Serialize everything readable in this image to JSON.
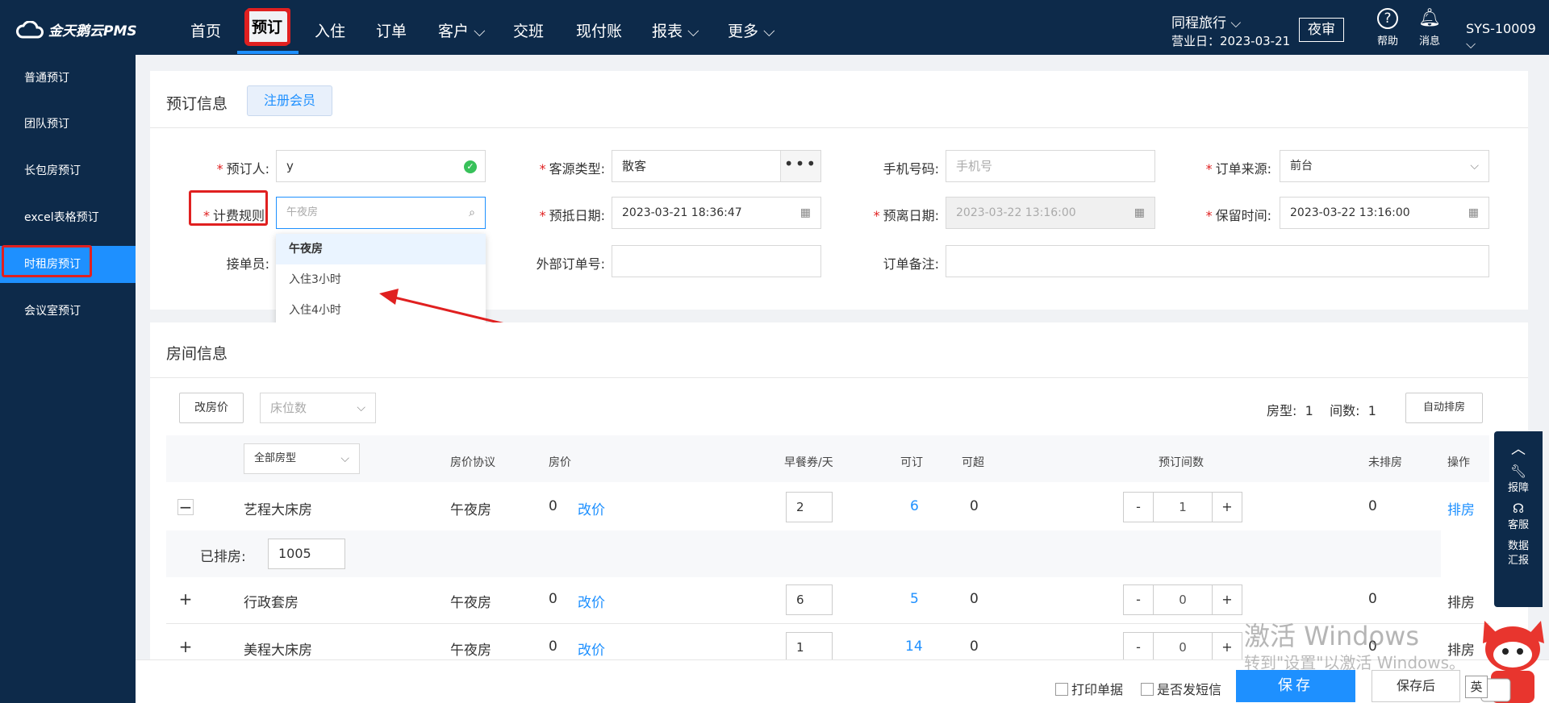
{
  "app": {
    "name": "金天鹅云PMS"
  },
  "nav": {
    "items": [
      "首页",
      "预订",
      "入住",
      "订单",
      "客户",
      "交班",
      "现付账",
      "报表",
      "更多"
    ],
    "hotel": "同程旅行",
    "business_date": "营业日：2023-03-21",
    "night_audit": "夜审",
    "help": "帮助",
    "message": "消息",
    "account": "SYS-10009"
  },
  "sidebar": {
    "items": [
      "普通预订",
      "团队预订",
      "长包房预订",
      "excel表格预订",
      "时租房预订",
      "会议室预订"
    ]
  },
  "booking": {
    "title": "预订信息",
    "register_btn": "注册会员",
    "booker_label": "预订人:",
    "booker_value": "y",
    "guest_type_label": "客源类型:",
    "guest_type_value": "散客",
    "phone_label": "手机号码:",
    "phone_placeholder": "手机号",
    "source_label": "订单来源:",
    "source_value": "前台",
    "billing_rule_label": "计费规则",
    "billing_rule_placeholder": "午夜房",
    "arrival_label": "预抵日期:",
    "arrival_value": "2023-03-21 18:36:47",
    "departure_label": "预离日期:",
    "departure_value": "2023-03-22 13:16:00",
    "hold_label": "保留时间:",
    "hold_value": "2023-03-22 13:16:00",
    "receiver_label": "接单员:",
    "external_label": "外部订单号:",
    "remark_label": "订单备注:",
    "dropdown": [
      "午夜房",
      "入住3小时",
      "入住4小时"
    ]
  },
  "rooms": {
    "title": "房间信息",
    "change_price_btn": "改房价",
    "bed_placeholder": "床位数",
    "room_type_label": "房型:",
    "room_type_count": "1",
    "room_count_label": "间数:",
    "room_count_value": "1",
    "auto_assign_btn": "自动排房",
    "room_type_select": "全部房型",
    "headers": [
      "房价协议",
      "房价",
      "早餐券/天",
      "可订",
      "可超",
      "预订间数",
      "未排房",
      "操作"
    ],
    "assigned_label": "已排房:",
    "assigned_room": "1005",
    "rows": [
      {
        "expander": "−",
        "name": "艺程大床房",
        "agreement": "午夜房",
        "price": "0",
        "change": "改价",
        "breakfast": "2",
        "available": "6",
        "over": "0",
        "qty": "1",
        "unassigned": "0",
        "op": "排房"
      },
      {
        "expander": "+",
        "name": "行政套房",
        "agreement": "午夜房",
        "price": "0",
        "change": "改价",
        "breakfast": "6",
        "available": "5",
        "over": "0",
        "qty": "0",
        "unassigned": "0",
        "op": "排房"
      },
      {
        "expander": "+",
        "name": "美程大床房",
        "agreement": "午夜房",
        "price": "0",
        "change": "改价",
        "breakfast": "1",
        "available": "14",
        "over": "0",
        "qty": "0",
        "unassigned": "0",
        "op": "排房"
      }
    ]
  },
  "rightbar": {
    "report": "报障",
    "service": "客服",
    "data1": "数据",
    "data2": "汇报"
  },
  "footer": {
    "print": "打印单据",
    "sms": "是否发短信",
    "save": "保存",
    "save_after": "保存后"
  },
  "watermark": {
    "line1": "激活 Windows",
    "line2": "转到\"设置\"以激活 Windows。"
  },
  "ime": "英",
  "colors": {
    "nav_bg": "#0d2a4a",
    "accent": "#1e90ff",
    "highlight": "#e02020"
  }
}
